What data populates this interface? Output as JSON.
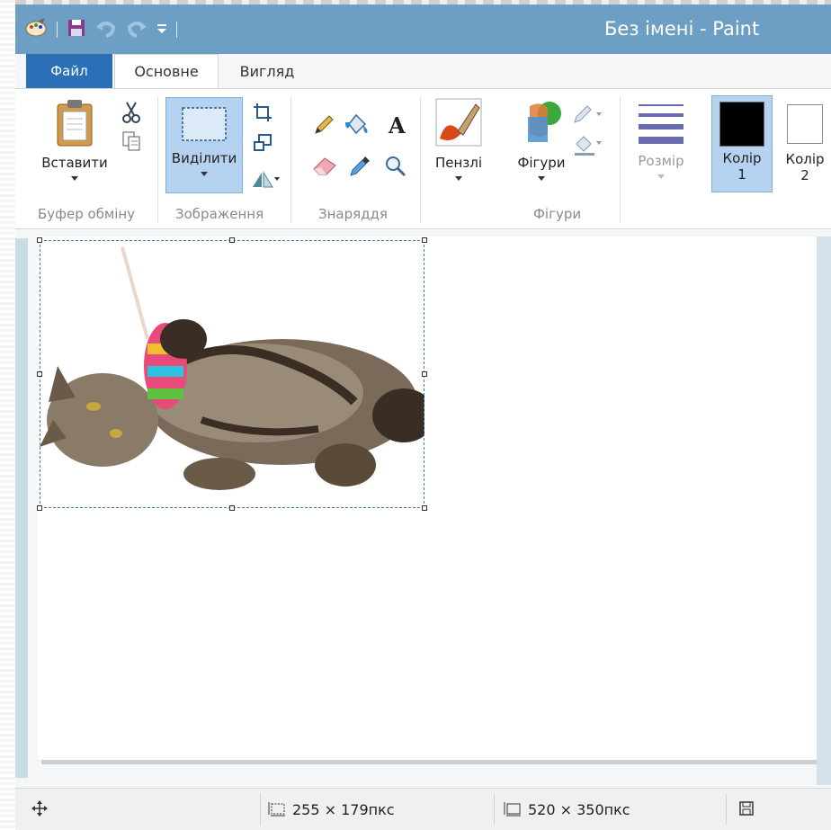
{
  "window": {
    "title": "Без імені - Paint"
  },
  "tabs": [
    {
      "label": "Файл"
    },
    {
      "label": "Основне"
    },
    {
      "label": "Вигляд"
    }
  ],
  "ribbon": {
    "paste_label": "Вставити",
    "select_label": "Виділити",
    "brushes_label": "Пензлі",
    "shapes_label": "Фігури",
    "size_label": "Розмір",
    "color1_label": "Колір",
    "color1_num": "1",
    "color2_label": "Колір",
    "color2_num": "2",
    "groups": {
      "clipboard": "Буфер обміну",
      "image": "Зображення",
      "tools": "Знаряддя",
      "shapes": "Фігури"
    }
  },
  "colors": {
    "color1": "#000000",
    "color2": "#ffffff",
    "accent": "#2b6fb6"
  },
  "status": {
    "selection_size": "255 × 179пкс",
    "image_size": "520 × 350пкс"
  },
  "icons": [
    "paint-app-icon",
    "save-icon",
    "undo-icon",
    "redo-icon",
    "customize-qat-icon",
    "clipboard-icon",
    "cut-icon",
    "copy-icon",
    "select-icon",
    "crop-icon",
    "resize-icon",
    "rotate-icon",
    "pencil-icon",
    "fill-icon",
    "text-icon",
    "eraser-icon",
    "color-picker-icon",
    "magnifier-icon",
    "brush-icon",
    "shapes-icon",
    "outline-icon",
    "fill-shape-icon",
    "size-icon",
    "move-cursor-icon",
    "selection-size-icon",
    "image-size-icon",
    "disk-icon"
  ]
}
